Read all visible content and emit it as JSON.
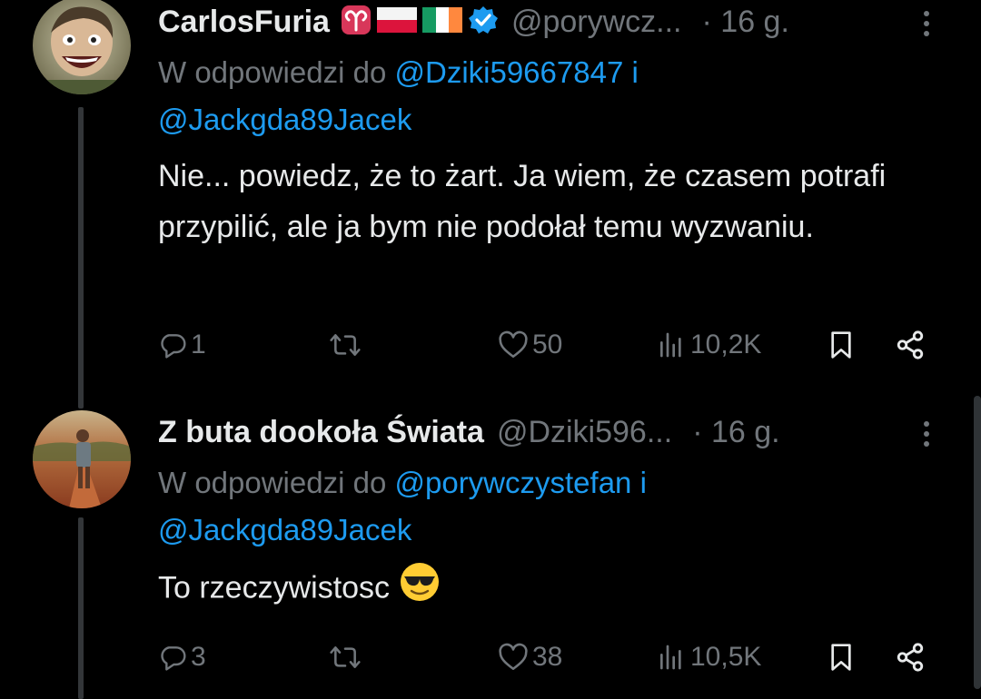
{
  "tweets": [
    {
      "author_name": "CarlosFuria",
      "badges": [
        "aries-icon",
        "poland-flag-icon",
        "ireland-flag-icon",
        "verified-badge-icon"
      ],
      "handle": "@porywcz...",
      "time": "· 16 g.",
      "reply_prefix": "W odpowiedzi do ",
      "reply_user1": "@Dziki59667847",
      "reply_join": " i",
      "reply_user2": "@Jackgda89Jacek",
      "text": "Nie... powiedz, że to żart. Ja wiem, że czasem potrafi przypilić, ale ja bym nie podołał temu wyzwaniu.",
      "replies": "1",
      "retweets": "",
      "likes": "50",
      "views": "10,2K"
    },
    {
      "author_name": "Z buta dookoła Świata",
      "handle": "@Dziki596...",
      "time": "· 16 g.",
      "reply_prefix": "W odpowiedzi do ",
      "reply_user1": "@porywczystefan",
      "reply_join": " i",
      "reply_user2": "@Jackgda89Jacek",
      "text": "To rzeczywistosc",
      "emoji": "sunglasses-emoji",
      "replies": "3",
      "retweets": "",
      "likes": "38",
      "views": "10,5K"
    }
  ],
  "colors": {
    "background": "#000000",
    "text": "#e7e9ea",
    "secondary": "#71767b",
    "link": "#1d9bf0",
    "verified": "#1d9bf0",
    "thread_line": "#333639"
  }
}
